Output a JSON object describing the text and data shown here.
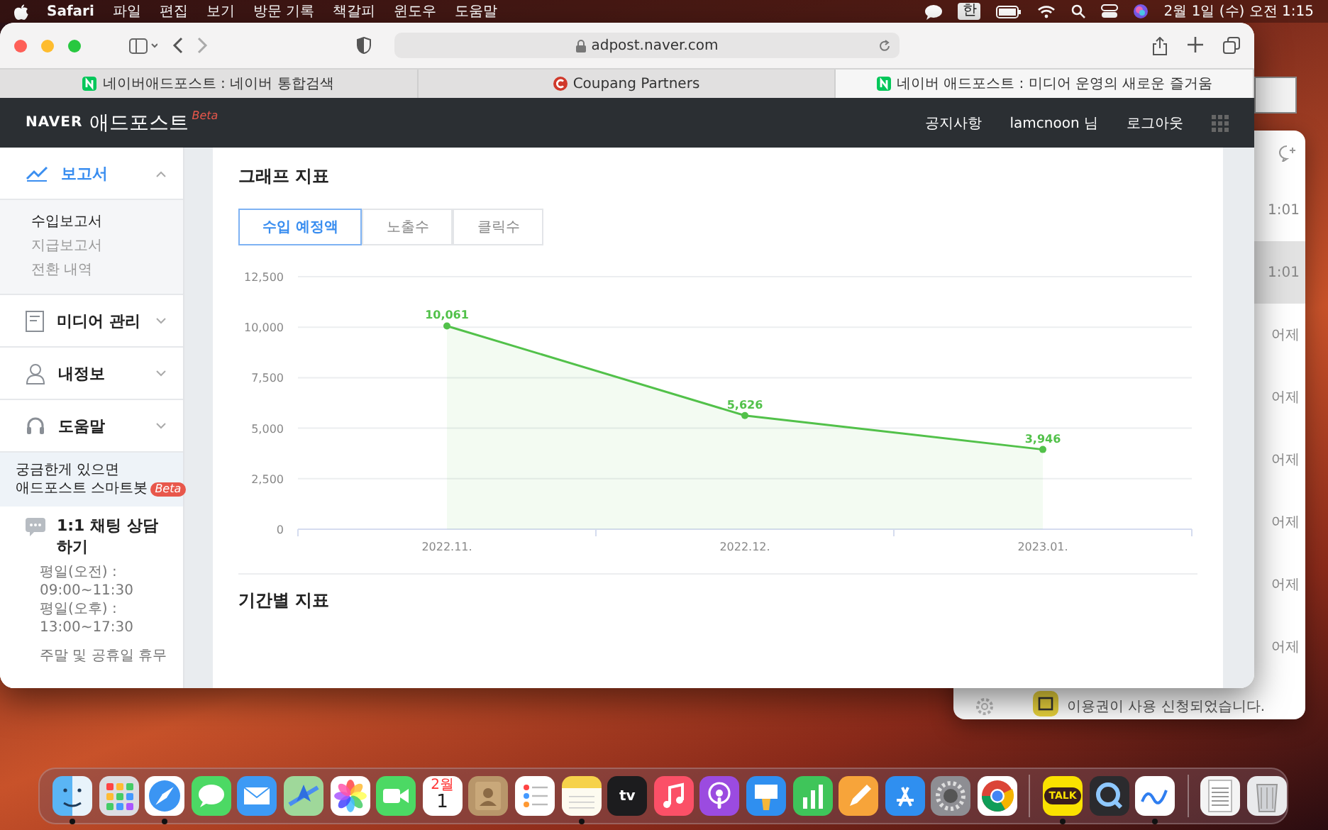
{
  "menubar": {
    "app": "Safari",
    "menus": [
      "파일",
      "편집",
      "보기",
      "방문 기록",
      "책갈피",
      "윈도우",
      "도움말"
    ],
    "input_source": "한",
    "clock": "2월 1일 (수) 오전 1:15"
  },
  "browser": {
    "url": "adpost.naver.com",
    "tabs": [
      {
        "title": "네이버애드포스트 : 네이버 통합검색",
        "kind": "n",
        "selected": false
      },
      {
        "title": "Coupang Partners",
        "kind": "c",
        "selected": false
      },
      {
        "title": "네이버 애드포스트 : 미디어 운영의 새로운 즐거움",
        "kind": "n",
        "selected": true
      }
    ]
  },
  "site_header": {
    "brand": "NAVER",
    "product": "애드포스트",
    "badge": "Beta",
    "links": [
      "공지사항",
      "lamcnoon 님",
      "로그아웃"
    ]
  },
  "sidebar": {
    "sections": [
      {
        "label": "보고서",
        "kind": "chart",
        "selected": true,
        "expanded": true,
        "children": [
          {
            "label": "수입보고서",
            "selected": true
          },
          {
            "label": "지급보고서",
            "selected": false
          },
          {
            "label": "전환 내역",
            "selected": false
          }
        ]
      },
      {
        "label": "미디어 관리",
        "kind": "document",
        "selected": false,
        "expanded": false
      },
      {
        "label": "내정보",
        "kind": "person",
        "selected": false,
        "expanded": false
      },
      {
        "label": "도움말",
        "kind": "headset",
        "selected": false,
        "expanded": false
      }
    ],
    "bot": {
      "line1": "궁금한게 있으면",
      "line2": "애드포스트 스마트봇",
      "badge": "Beta"
    },
    "chat": {
      "title": "1:1 채팅 상담하기",
      "hours": [
        "평일(오전) :",
        "09:00~11:30",
        "평일(오후) :",
        "13:00~17:30"
      ],
      "note": "주말 및 공휴일 휴무"
    }
  },
  "content": {
    "title": "그래프 지표",
    "tabs": [
      {
        "label": "수입 예정액",
        "selected": true
      },
      {
        "label": "노출수",
        "selected": false
      },
      {
        "label": "클릭수",
        "selected": false
      }
    ],
    "chart_data": {
      "type": "line",
      "categories": [
        "2022.11.",
        "2022.12.",
        "2023.01."
      ],
      "series": [
        {
          "color": "#52c14a",
          "marker": true,
          "values": [
            10061,
            5626,
            3946
          ],
          "value_labels": [
            "10,061",
            "5,626",
            "3,946"
          ]
        }
      ],
      "ylim": [
        0,
        12500
      ],
      "grid": true,
      "yticks": [
        {
          "value": 0,
          "label": "0"
        },
        {
          "value": 2500,
          "label": "2,500"
        },
        {
          "value": 5000,
          "label": "5,000"
        },
        {
          "value": 7500,
          "label": "7,500"
        },
        {
          "value": 10000,
          "label": "10,000"
        },
        {
          "value": 12500,
          "label": "12,500"
        }
      ],
      "data_labels": true
    },
    "next_title": "기간별 지표"
  },
  "background_window": {
    "rows": [
      {
        "time": "1:01",
        "selected": false
      },
      {
        "time": "1:01",
        "selected": true
      },
      {
        "time": "어제",
        "selected": false
      },
      {
        "time": "어제",
        "selected": false
      },
      {
        "time": "어제",
        "selected": false
      },
      {
        "time": "어제",
        "selected": false
      },
      {
        "time": "어제",
        "selected": false
      },
      {
        "time": "어제",
        "selected": false
      }
    ],
    "notice": "이용권이 사용 신청되었습니다."
  },
  "dock": {
    "apps": [
      {
        "kind": "finder",
        "running": true
      },
      {
        "kind": "launchpad",
        "running": false
      },
      {
        "kind": "safari",
        "running": true
      },
      {
        "kind": "messages",
        "running": false
      },
      {
        "kind": "mail",
        "running": false
      },
      {
        "kind": "maps",
        "running": false
      },
      {
        "kind": "photos",
        "running": false
      },
      {
        "kind": "facetime",
        "running": false
      },
      {
        "kind": "calendar",
        "month": "2월",
        "label": "1",
        "running": false
      },
      {
        "kind": "contacts",
        "running": false
      },
      {
        "kind": "reminders",
        "running": false
      },
      {
        "kind": "notes",
        "running": true
      },
      {
        "kind": "tv",
        "label": "tv",
        "running": false
      },
      {
        "kind": "music",
        "running": false
      },
      {
        "kind": "podcasts",
        "running": false
      },
      {
        "kind": "keynote",
        "running": false
      },
      {
        "kind": "numbers",
        "running": false
      },
      {
        "kind": "pages",
        "running": false
      },
      {
        "kind": "appstore",
        "running": false
      },
      {
        "kind": "settings",
        "running": false
      },
      {
        "kind": "chrome",
        "running": false
      },
      {
        "kind": "separator"
      },
      {
        "kind": "kakaotalk",
        "label": "TALK",
        "running": true
      },
      {
        "kind": "quicktime",
        "running": false
      },
      {
        "kind": "freeform",
        "running": true
      },
      {
        "kind": "separator"
      },
      {
        "kind": "document",
        "running": false
      },
      {
        "kind": "trash",
        "running": false
      }
    ]
  }
}
